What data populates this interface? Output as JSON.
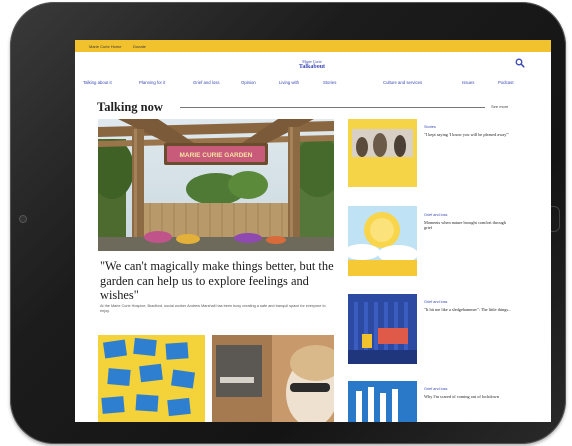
{
  "topbar": {
    "left_text": "Marie Curie Home",
    "right_text": "Donate"
  },
  "logo": {
    "top": "Marie Curie",
    "main": "Talkabout"
  },
  "nav": {
    "items": [
      "Talking about it",
      "Planning for it",
      "Grief and loss",
      "Opinion",
      "Living with",
      "Stories",
      "Culture and services",
      "Issues",
      "Podcast"
    ]
  },
  "section": {
    "title": "Talking now",
    "see_more": "See more"
  },
  "hero": {
    "sign_text": "MARIE CURIE GARDEN",
    "headline": "\"We can't magically make things better, but the garden can help us to explore feelings and wishes\"",
    "summary": "At the Marie Curie Hospice, Bradford, social worker Andrew Marshall has been busy creating a safe and tranquil space for everyone to enjoy."
  },
  "sidebar": [
    {
      "category": "Stories",
      "title": "\"I kept saying 'I know you will be pleased away'\""
    },
    {
      "category": "Grief and loss",
      "title": "Moments when nature brought comfort through grief"
    },
    {
      "category": "Grief and loss",
      "title": "\"It hit me like a sledgehammer\": The little things..."
    },
    {
      "category": "Grief and loss",
      "title": "Why I'm scared of coming out of lockdown"
    }
  ],
  "colors": {
    "brand_yellow": "#f2c12e",
    "brand_blue": "#3b49b5",
    "bezel": "#1c1c1c"
  }
}
